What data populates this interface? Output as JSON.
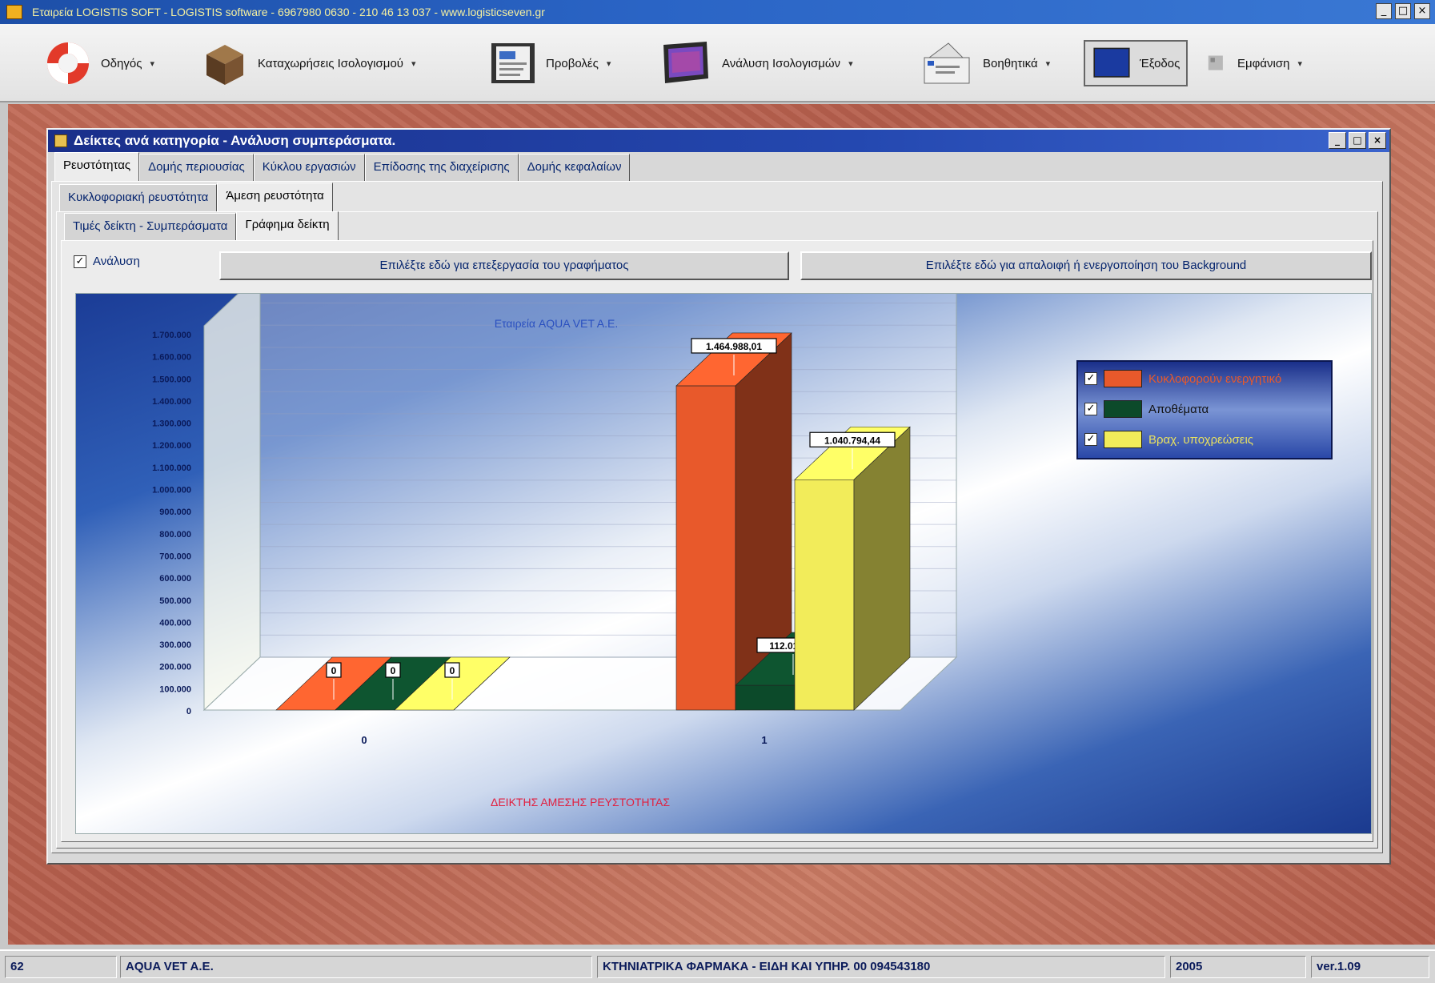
{
  "app": {
    "title": "Εταιρεία LOGISTIS SOFT - LOGISTIS software - 6967980 0630 - 210 46 13 037 - www.logisticseven.gr",
    "window_buttons": [
      "_",
      "□",
      "×"
    ]
  },
  "toolbar": {
    "items": [
      {
        "label": "Οδηγός",
        "icon": "lifebuoy-icon"
      },
      {
        "label": "Καταχωρήσεις Ισολογισμού",
        "icon": "box-icon"
      },
      {
        "label": "Προβολές",
        "icon": "document-icon"
      },
      {
        "label": "Ανάλυση Ισολογισμών",
        "icon": "monitor-icon"
      },
      {
        "label": "Βοηθητικά",
        "icon": "envelope-icon"
      },
      {
        "label": "Έξοδος",
        "icon": "exit-icon"
      },
      {
        "label": "Εμφάνιση",
        "icon": "palette-icon"
      }
    ],
    "dropdown_arrow": "▾"
  },
  "inner_window": {
    "title": "Δείκτες ανά κατηγορία - Ανάλυση συμπεράσματα.",
    "buttons": [
      "_",
      "□",
      "×"
    ]
  },
  "tabs": {
    "level1": [
      "Ρευστότητας",
      "Δομής περιουσίας",
      "Κύκλου εργασιών",
      "Επίδοσης της διαχείρισης",
      "Δομής κεφαλαίων"
    ],
    "level2": [
      "Κυκλοφοριακή ρευστότητα",
      "Άμεση ρευστότητα"
    ],
    "level3": [
      "Τιμές δείκτη - Συμπεράσματα",
      "Γράφημα δείκτη"
    ]
  },
  "controls": {
    "analysis_checked": "✓",
    "analysis_label": "Ανάλυση",
    "edit_chart_button": "Επιλέξτε εδώ για επεξεργασία του γραφήματος",
    "toggle_background_button": "Επιλέξτε εδώ για απαλοιφή ή ενεργοποίηση του Background"
  },
  "chart_data": {
    "type": "bar",
    "title": "Εταιρεία AQUA VET A.E.",
    "xlabel": "ΔΕΙΚΤΗΣ ΑΜΕΣΗΣ ΡΕΥΣΤΟΤΗΤΑΣ",
    "ylabel": "",
    "categories": [
      "0",
      "1"
    ],
    "series": [
      {
        "name": "Κυκλοφορούν ενεργητικό",
        "values": [
          0,
          1464988.01
        ],
        "labels": [
          "0",
          "1.464.988,01"
        ],
        "color": "#e8592b"
      },
      {
        "name": "Αποθέματα",
        "values": [
          0,
          112012.74
        ],
        "labels": [
          "0",
          "112.012,74"
        ],
        "color": "#0c4a2a"
      },
      {
        "name": "Βραχ. υποχρεώσεις",
        "values": [
          0,
          1040794.44
        ],
        "labels": [
          "0",
          "1.040.794,44"
        ],
        "color": "#f2ec5a"
      }
    ],
    "yticks": [
      "0",
      "100.000",
      "200.000",
      "300.000",
      "400.000",
      "500.000",
      "600.000",
      "700.000",
      "800.000",
      "900.000",
      "1.000.000",
      "1.100.000",
      "1.200.000",
      "1.300.000",
      "1.400.000",
      "1.500.000",
      "1.600.000",
      "1.700.000"
    ],
    "ylim": [
      0,
      1700000
    ],
    "legend_position": "top-right",
    "legend_checked": "✓",
    "grid": true
  },
  "status": {
    "record": "62",
    "company": "AQUA VET A.E.",
    "sector": "ΚΤΗΝΙΑΤΡΙΚΑ ΦΑΡΜΑΚΑ - ΕΙΔΗ ΚΑΙ ΥΠΗΡ. 00 094543180",
    "year": "2005",
    "version": "ver.1.09"
  }
}
